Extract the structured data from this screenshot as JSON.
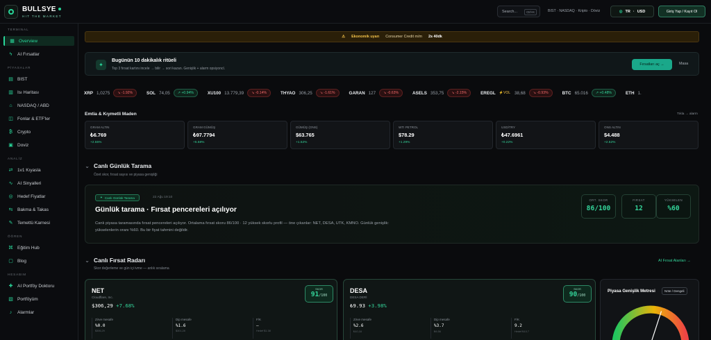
{
  "topbar": {
    "brand": "BULLSYE",
    "tagline": "HIT THE MARKET",
    "search_placeholder": "Search...",
    "search_kbd": "Ctrl+K",
    "markets": "BIST · NASDAQ · Kripto · Döviz",
    "lang": "TR",
    "currency": "USD",
    "login": "Giriş Yap / Kayıt Ol"
  },
  "sidebar": {
    "sections": [
      {
        "label": "TERMINAL",
        "items": [
          {
            "label": "Overview",
            "icon": "grid-icon"
          },
          {
            "label": "AI Fırsatlar",
            "icon": "bolt-icon"
          }
        ]
      },
      {
        "label": "PİYASALAR",
        "items": [
          {
            "label": "BIST",
            "icon": "chart-icon"
          },
          {
            "label": "Isı Haritası",
            "icon": "heatmap-icon"
          },
          {
            "label": "NASDAQ / ABD",
            "icon": "bank-icon"
          },
          {
            "label": "Fonlar & ETF'ler",
            "icon": "fund-icon"
          },
          {
            "label": "Crypto",
            "icon": "bitcoin-icon"
          },
          {
            "label": "Doviz",
            "icon": "currency-icon"
          }
        ]
      },
      {
        "label": "ANALİZ",
        "items": [
          {
            "label": "1v1 Kıyasla",
            "icon": "compare-icon"
          },
          {
            "label": "AI Sinyalleri",
            "icon": "signal-icon"
          },
          {
            "label": "Hedef Fiyatlar",
            "icon": "target-icon"
          },
          {
            "label": "Bakma & Takas",
            "icon": "swap-icon"
          },
          {
            "label": "Temettü Karnesi",
            "icon": "dividend-icon"
          }
        ]
      },
      {
        "label": "ÖĞREN",
        "items": [
          {
            "label": "Eğitim Hub",
            "icon": "education-icon"
          },
          {
            "label": "Blog",
            "icon": "blog-icon"
          }
        ]
      },
      {
        "label": "HESABIM",
        "items": [
          {
            "label": "AI Portföy Doktoru",
            "icon": "doctor-icon"
          },
          {
            "label": "Portföyüm",
            "icon": "portfolio-icon"
          },
          {
            "label": "Alarmlar",
            "icon": "bell-icon"
          }
        ]
      }
    ]
  },
  "alert": {
    "label": "Ekonomik uyarı",
    "event": "Consumer Credit m/m",
    "time": "2s 40dk"
  },
  "ritual": {
    "title": "Bugünün 10 dakikalık ritüeli",
    "subtitle": "Top 3 fırsat kartını incele → bilir → sori kazan. Genişlik + alarm opsiyoncl.",
    "primary": "Fırsatları aç →",
    "secondary": "Masa"
  },
  "ticker": [
    {
      "symbol": "XRP",
      "price": "1,0275",
      "change": "↘ -1.92%",
      "dir": "dn"
    },
    {
      "symbol": "SOL",
      "price": "74,05",
      "change": "↗ +0.94%",
      "dir": "up"
    },
    {
      "symbol": "XU100",
      "price": "13.779,39",
      "change": "↘ -0.14%",
      "dir": "dn"
    },
    {
      "symbol": "THYAO",
      "price": "306,25",
      "change": "↘ -1.61%",
      "dir": "dn"
    },
    {
      "symbol": "GARAN",
      "price": "127",
      "change": "↘ -0.63%",
      "dir": "dn"
    },
    {
      "symbol": "ASELS",
      "price": "353,75",
      "change": "↘ -2.15%",
      "dir": "dn"
    },
    {
      "symbol": "EREGL",
      "vol": "⚡VOL",
      "price": "38,68",
      "change": "↘ -0.93%",
      "dir": "dn"
    },
    {
      "symbol": "BTC",
      "price": "65.016",
      "change": "↗ +0.48%",
      "dir": "up"
    },
    {
      "symbol": "ETH",
      "price": "1.",
      "change": "",
      "dir": "up"
    }
  ],
  "metals": {
    "title": "Emtia & Kıymetli Maden",
    "link": "Tıkla → alarm",
    "cards": [
      {
        "label": "GRAM ALTIN",
        "value": "₺6.769",
        "change": "+2.55%"
      },
      {
        "label": "GRAM GÜMÜŞ",
        "value": "₺97.7794",
        "change": "+5.58%"
      },
      {
        "label": "GÜMÜŞ (ONS)",
        "value": "$63.765",
        "change": "+1.52%"
      },
      {
        "label": "WTI PETROL",
        "value": "$78.29",
        "change": "+1.29%"
      },
      {
        "label": "USD/TRY",
        "value": "₺47.6961",
        "change": "+0.22%"
      },
      {
        "label": "ONS ALTIN",
        "value": "$4.488",
        "change": "+2.52%"
      }
    ]
  },
  "scan": {
    "section": "Canlı Günlük Tarama",
    "subsection": "Özet skor, fırsat sayısı ve piyasa genişliği",
    "badge": "Canlı Günlük Tarama",
    "date": "22 Ağu 19:10",
    "title": "Günlük tarama · Fırsat pencereleri açılıyor",
    "desc": "Canlı piyasa taramasında fırsat pencereleri açılıyor. Ortalama fırsat skoru 86/100 · 12 yüksek skorlu profil — öne çıkanlar: NET, DESA, UTK, KMNO. Günlük genişlik: yükselenlerin oranı %60. Bu bir fiyat tahmini değildir.",
    "stats": [
      {
        "label": "ORT. SKOR",
        "value": "86/100"
      },
      {
        "label": "FIRSAT",
        "value": "12"
      },
      {
        "label": "YÜKSELEN",
        "value": "%60"
      }
    ]
  },
  "radar": {
    "section": "Canlı Fırsat Radarı",
    "subsection": "Skor değerleme ve gün içi ivme — anlık sıralama",
    "link": "AI Fırsat Alanları →",
    "cards": [
      {
        "symbol": "NET",
        "company": "Cloudflare, Inc.",
        "price": "$306,29",
        "change": "+7.68%",
        "score_label": "SKOR",
        "score": "91",
        "score_max": "/100",
        "subs": [
          {
            "label": "Zirve mesafe",
            "value": "%0.0",
            "small": "$306,29"
          },
          {
            "label": "Dip mesafe",
            "value": "%1.6",
            "small": "$301,28"
          },
          {
            "label": "F/K",
            "value": "–",
            "small": "Hedef $1.38"
          }
        ]
      },
      {
        "symbol": "DESA",
        "company": "DESA DERİ",
        "price": "₺9.93",
        "change": "+3.98%",
        "score_label": "SKOR",
        "score": "90",
        "score_max": "/100",
        "subs": [
          {
            "label": "Zirve mesafe",
            "value": "%2.6",
            "small": "₺10,18"
          },
          {
            "label": "Dip mesafe",
            "value": "%3.7",
            "small": "₺9,56"
          },
          {
            "label": "F/K",
            "value": "9.2",
            "small": "Hedef ₺10.7"
          }
        ]
      }
    ]
  },
  "breadth": {
    "title": "Piyasa Genişlik Metresi",
    "pill": "Nöte / Dengeli",
    "value": 60
  },
  "colors": {
    "accent": "#29d79a",
    "up": "#34d399",
    "down": "#f26a6a",
    "warning": "#f3c24a"
  }
}
